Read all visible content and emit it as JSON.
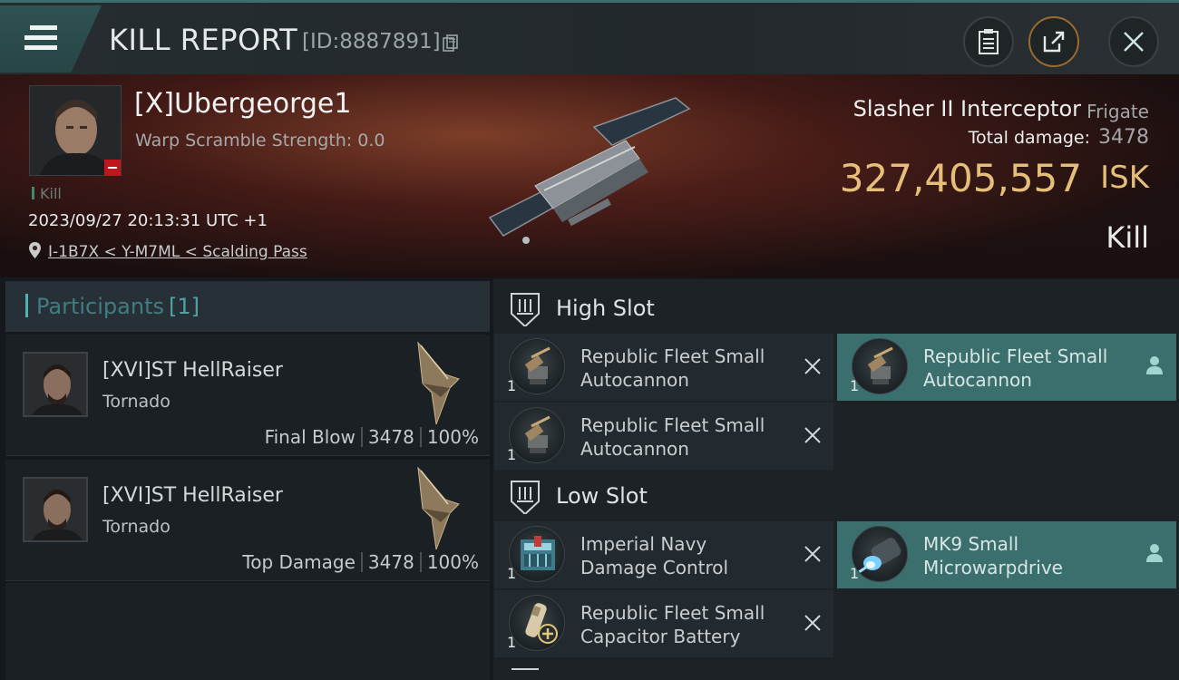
{
  "header": {
    "title": "KILL REPORT",
    "report_id": "[ID:8887891]",
    "icons": [
      "menu-icon",
      "copy-icon",
      "clipboard-icon",
      "share-icon",
      "close-icon"
    ]
  },
  "victim": {
    "pilot_name": "[X]Ubergeorge1",
    "warp_scramble": "Warp Scramble Strength: 0.0",
    "kill_tag": "Kill",
    "datetime": "2023/09/27 20:13:31 UTC +1",
    "location": "I-1B7X < Y-M7ML < Scalding Pass",
    "ship_name": "Slasher II Interceptor",
    "ship_class": "Frigate",
    "total_damage_label": "Total damage:",
    "total_damage": "3478",
    "isk_value": "327,405,557",
    "isk_unit": "ISK",
    "result": "Kill"
  },
  "participants": {
    "title": "Participants",
    "count": "[1]",
    "rows": [
      {
        "name": "[XVI]ST HellRaiser",
        "ship": "Tornado",
        "role": "Final Blow",
        "damage": "3478",
        "percent": "100%"
      },
      {
        "name": "[XVI]ST HellRaiser",
        "ship": "Tornado",
        "role": "Top Damage",
        "damage": "3478",
        "percent": "100%"
      }
    ]
  },
  "slots": {
    "high": {
      "title": "High Slot",
      "modules": [
        {
          "name_line1": "Republic Fleet Small",
          "name_line2": "Autocannon",
          "qty": "1",
          "status": "destroyed"
        },
        {
          "name_line1": "Republic Fleet Small",
          "name_line2": "Autocannon",
          "qty": "1",
          "status": "dropped"
        },
        {
          "name_line1": "Republic Fleet Small",
          "name_line2": "Autocannon",
          "qty": "1",
          "status": "destroyed"
        }
      ]
    },
    "low": {
      "title": "Low Slot",
      "modules": [
        {
          "name_line1": "Imperial Navy",
          "name_line2": "Damage Control",
          "qty": "1",
          "status": "destroyed"
        },
        {
          "name_line1": "MK9 Small",
          "name_line2": "Microwarpdrive",
          "qty": "1",
          "status": "dropped"
        },
        {
          "name_line1": "Republic Fleet Small",
          "name_line2": "Capacitor Battery",
          "qty": "1",
          "status": "destroyed"
        }
      ]
    }
  },
  "colors": {
    "accent_teal": "#3b6f6d",
    "isk_gold": "#e5bf7a",
    "badge_red": "#c2161c"
  }
}
